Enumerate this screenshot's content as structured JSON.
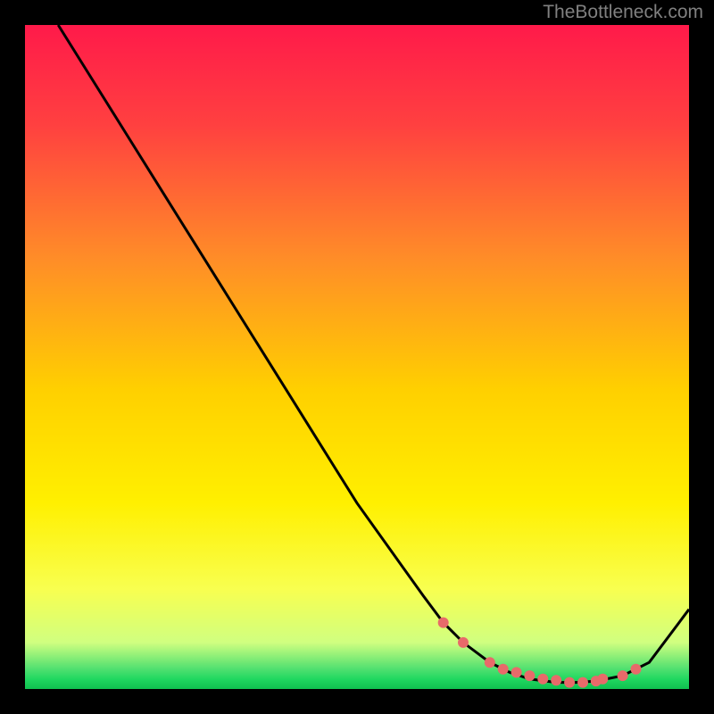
{
  "watermark": "TheBottleneck.com",
  "chart_data": {
    "type": "line",
    "title": "",
    "xlabel": "",
    "ylabel": "",
    "xlim": [
      0,
      100
    ],
    "ylim": [
      0,
      100
    ],
    "series": [
      {
        "name": "curve",
        "x": [
          5,
          10,
          15,
          20,
          25,
          30,
          35,
          40,
          45,
          50,
          55,
          60,
          63,
          66,
          70,
          73,
          76,
          80,
          83,
          86,
          90,
          94,
          100
        ],
        "y": [
          100,
          92,
          84,
          76,
          68,
          60,
          52,
          44,
          36,
          28,
          21,
          14,
          10,
          7,
          4,
          2.5,
          1.5,
          1,
          1,
          1.2,
          2,
          4,
          12
        ]
      }
    ],
    "markers": {
      "name": "dots",
      "x": [
        63,
        66,
        70,
        72,
        74,
        76,
        78,
        80,
        82,
        84,
        86,
        87,
        90,
        92
      ],
      "y": [
        10,
        7,
        4,
        3,
        2.5,
        2,
        1.5,
        1.3,
        1,
        1,
        1.2,
        1.5,
        2,
        3
      ]
    },
    "gradient": {
      "description": "vertical gradient from red at top through orange/yellow to green band near bottom",
      "stops": [
        {
          "offset": 0,
          "color": "#ff1a4a"
        },
        {
          "offset": 0.15,
          "color": "#ff4040"
        },
        {
          "offset": 0.35,
          "color": "#ff8c28"
        },
        {
          "offset": 0.55,
          "color": "#ffd000"
        },
        {
          "offset": 0.72,
          "color": "#fff000"
        },
        {
          "offset": 0.85,
          "color": "#f8ff50"
        },
        {
          "offset": 0.93,
          "color": "#d0ff80"
        },
        {
          "offset": 0.97,
          "color": "#50e070"
        },
        {
          "offset": 0.985,
          "color": "#20d860"
        },
        {
          "offset": 1.0,
          "color": "#10c050"
        }
      ]
    }
  }
}
